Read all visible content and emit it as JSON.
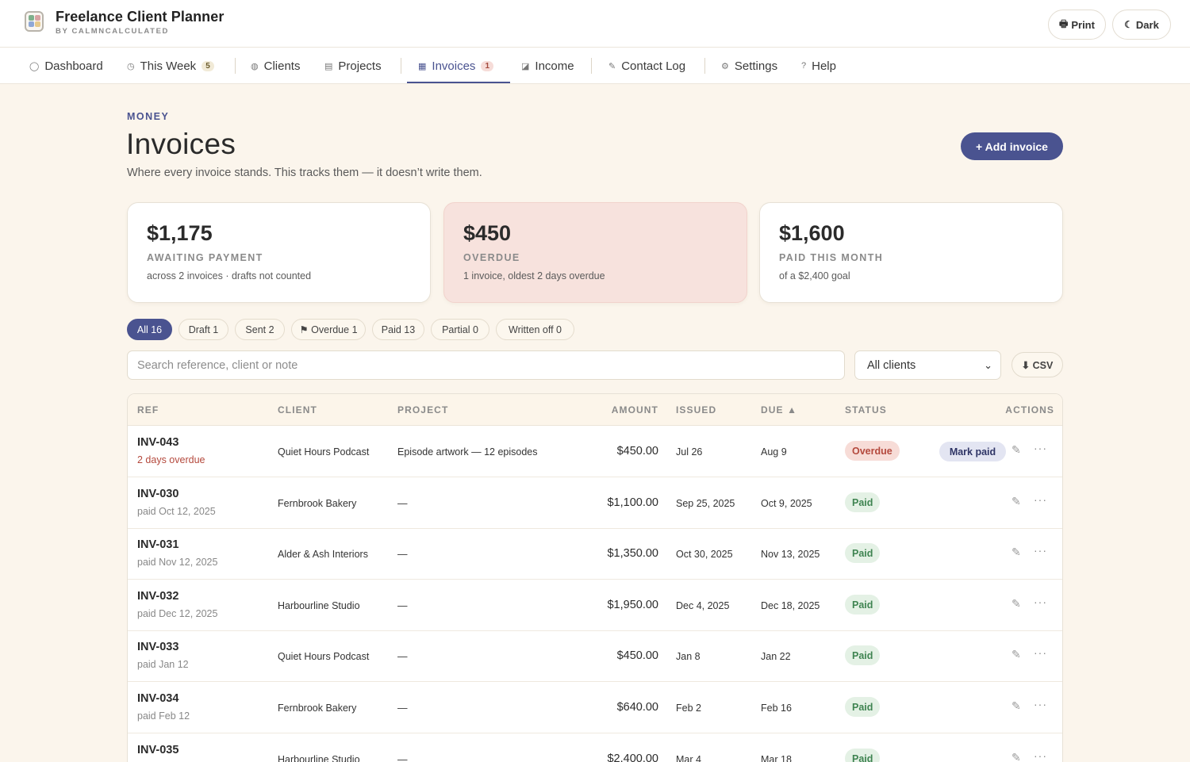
{
  "header": {
    "app_title": "Freelance Client Planner",
    "app_subtitle": "BY CALMNCALCULATED",
    "print_label": "Print",
    "dark_label": "Dark"
  },
  "nav": {
    "dashboard": "Dashboard",
    "this_week": "This Week",
    "this_week_count": "5",
    "clients": "Clients",
    "projects": "Projects",
    "invoices": "Invoices",
    "invoices_count": "1",
    "income": "Income",
    "contact_log": "Contact Log",
    "settings": "Settings",
    "help": "Help"
  },
  "page": {
    "eyebrow": "MONEY",
    "title": "Invoices",
    "description": "Where every invoice stands. This tracks them — it doesn’t write them.",
    "add_button": "+ Add invoice"
  },
  "stats": [
    {
      "value": "$1,175",
      "label": "AWAITING PAYMENT",
      "note": "across 2 invoices · drafts not counted"
    },
    {
      "value": "$450",
      "label": "OVERDUE",
      "note": "1 invoice, oldest 2 days overdue"
    },
    {
      "value": "$1,600",
      "label": "PAID THIS MONTH",
      "note": "of a $2,400 goal"
    }
  ],
  "filters": {
    "all": "All 16",
    "draft": "Draft 1",
    "sent": "Sent 2",
    "overdue": "⚑ Overdue 1",
    "paid": "Paid 13",
    "partial": "Partial 0",
    "written_off": "Written off 0"
  },
  "toolbar": {
    "search_placeholder": "Search reference, client or note",
    "client_select_value": "All clients",
    "csv_label": "⬇ CSV"
  },
  "table": {
    "headers": {
      "ref": "REF",
      "client": "CLIENT",
      "project": "PROJECT",
      "amount": "AMOUNT",
      "issued": "ISSUED",
      "due": "DUE ▲",
      "status": "STATUS",
      "actions": "ACTIONS"
    },
    "mark_paid_label": "Mark paid",
    "rows": [
      {
        "ref": "INV-043",
        "sub": "2 days overdue",
        "client": "Quiet Hours Podcast",
        "project": "Episode artwork — 12 episodes",
        "amount": "$450.00",
        "issued": "Jul 26",
        "due": "Aug 9",
        "status": "Overdue"
      },
      {
        "ref": "INV-030",
        "sub": "paid Oct 12, 2025",
        "client": "Fernbrook Bakery",
        "project": "—",
        "amount": "$1,100.00",
        "issued": "Sep 25, 2025",
        "due": "Oct 9, 2025",
        "status": "Paid"
      },
      {
        "ref": "INV-031",
        "sub": "paid Nov 12, 2025",
        "client": "Alder & Ash Interiors",
        "project": "—",
        "amount": "$1,350.00",
        "issued": "Oct 30, 2025",
        "due": "Nov 13, 2025",
        "status": "Paid"
      },
      {
        "ref": "INV-032",
        "sub": "paid Dec 12, 2025",
        "client": "Harbourline Studio",
        "project": "—",
        "amount": "$1,950.00",
        "issued": "Dec 4, 2025",
        "due": "Dec 18, 2025",
        "status": "Paid"
      },
      {
        "ref": "INV-033",
        "sub": "paid Jan 12",
        "client": "Quiet Hours Podcast",
        "project": "—",
        "amount": "$450.00",
        "issued": "Jan 8",
        "due": "Jan 22",
        "status": "Paid"
      },
      {
        "ref": "INV-034",
        "sub": "paid Feb 12",
        "client": "Fernbrook Bakery",
        "project": "—",
        "amount": "$640.00",
        "issued": "Feb 2",
        "due": "Feb 16",
        "status": "Paid"
      },
      {
        "ref": "INV-035",
        "sub": "",
        "client": "Harbourline Studio",
        "project": "—",
        "amount": "$2,400.00",
        "issued": "Mar 4",
        "due": "Mar 18",
        "status": "Paid"
      }
    ]
  }
}
